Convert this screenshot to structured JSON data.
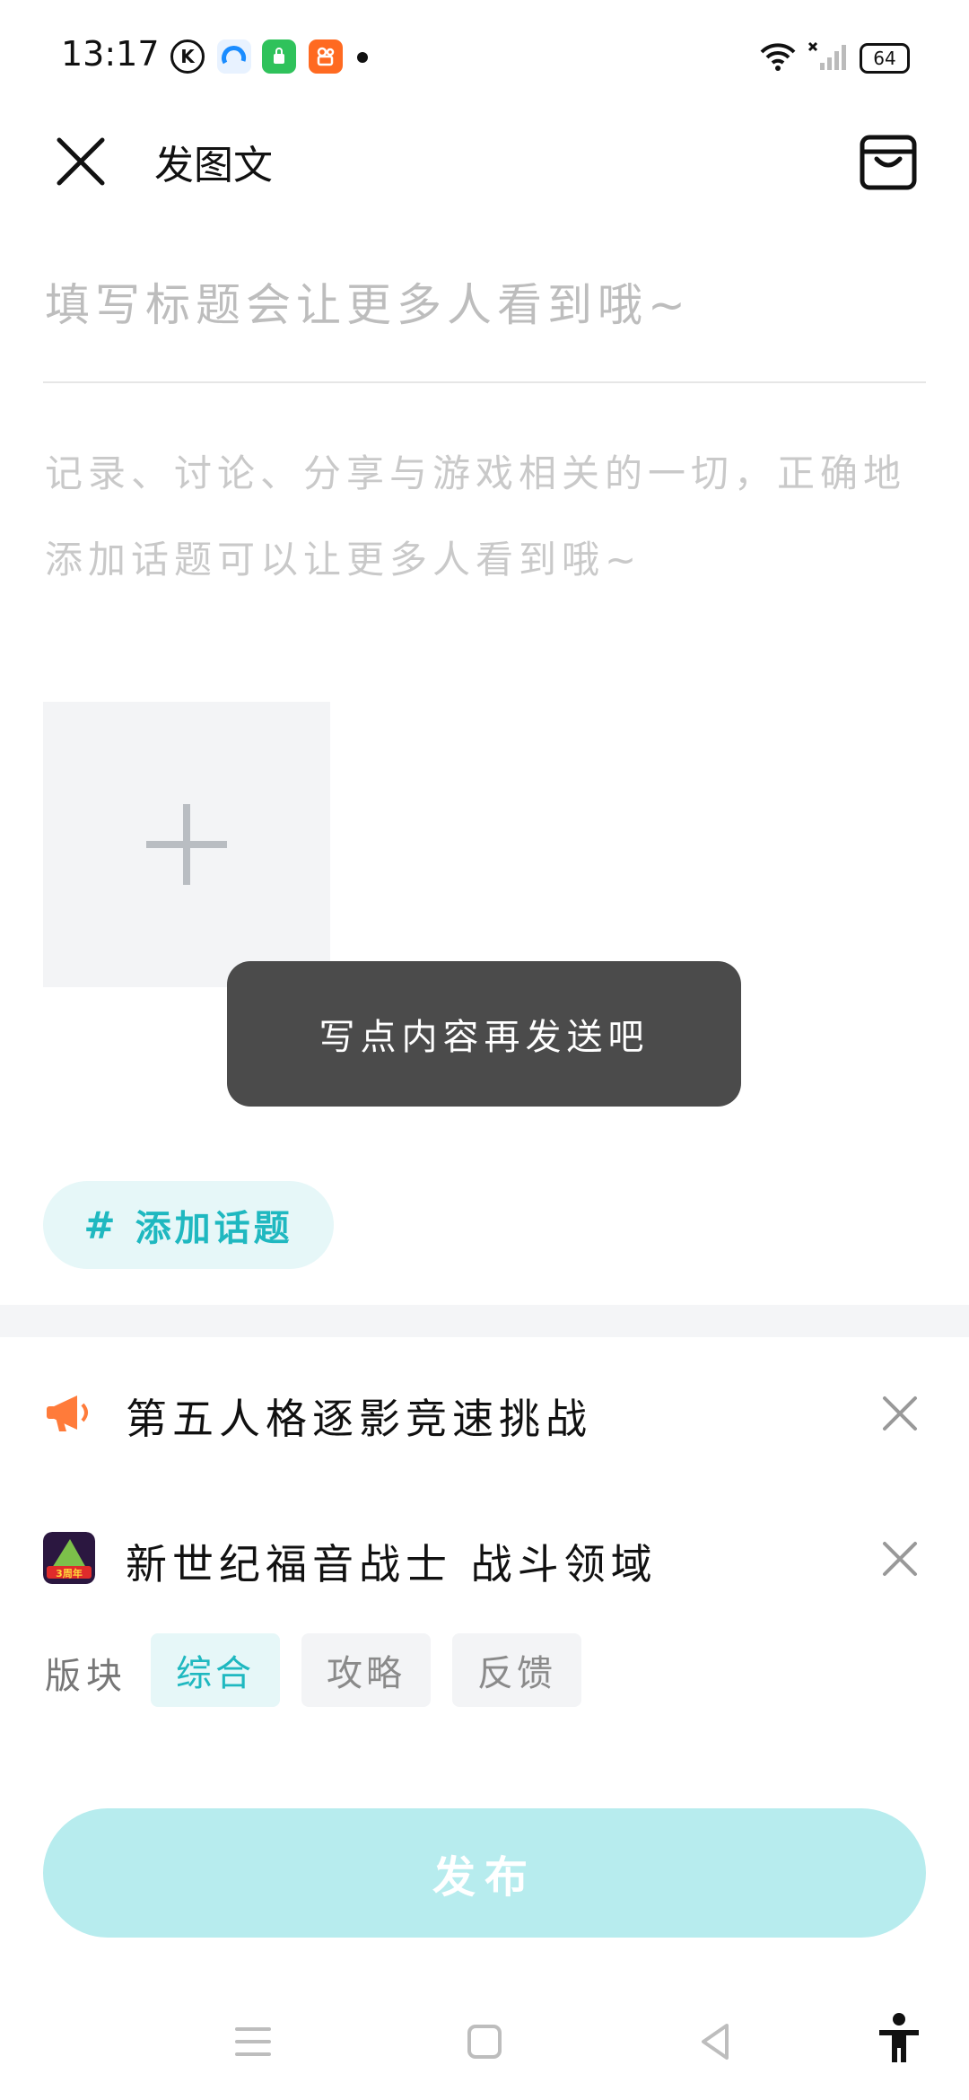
{
  "status_bar": {
    "time": "13:17",
    "battery": "64",
    "app_icons": [
      "k-icon",
      "browser-icon",
      "store-icon",
      "kuaishou-icon"
    ],
    "colors": {
      "store": "#2fc25b",
      "kuaishou": "#ff6a21"
    }
  },
  "header": {
    "title": "发图文"
  },
  "editor": {
    "title_placeholder": "填写标题会让更多人看到哦~",
    "content_placeholder": "记录、讨论、分享与游戏相关的一切，正确地添加话题可以让更多人看到哦~"
  },
  "toast": {
    "text": "写点内容再发送吧"
  },
  "topic": {
    "label": "添加话题",
    "hash": "#"
  },
  "activities": [
    {
      "name": "第五人格逐影竞速挑战",
      "icon": "megaphone-icon"
    },
    {
      "name": "新世纪福音战士 战斗领域",
      "icon": "game-icon"
    }
  ],
  "board": {
    "label": "版块",
    "options": [
      "综合",
      "攻略",
      "反馈"
    ],
    "selected": "综合"
  },
  "publish": {
    "label": "发布"
  },
  "accent_color": "#1fb8c0"
}
